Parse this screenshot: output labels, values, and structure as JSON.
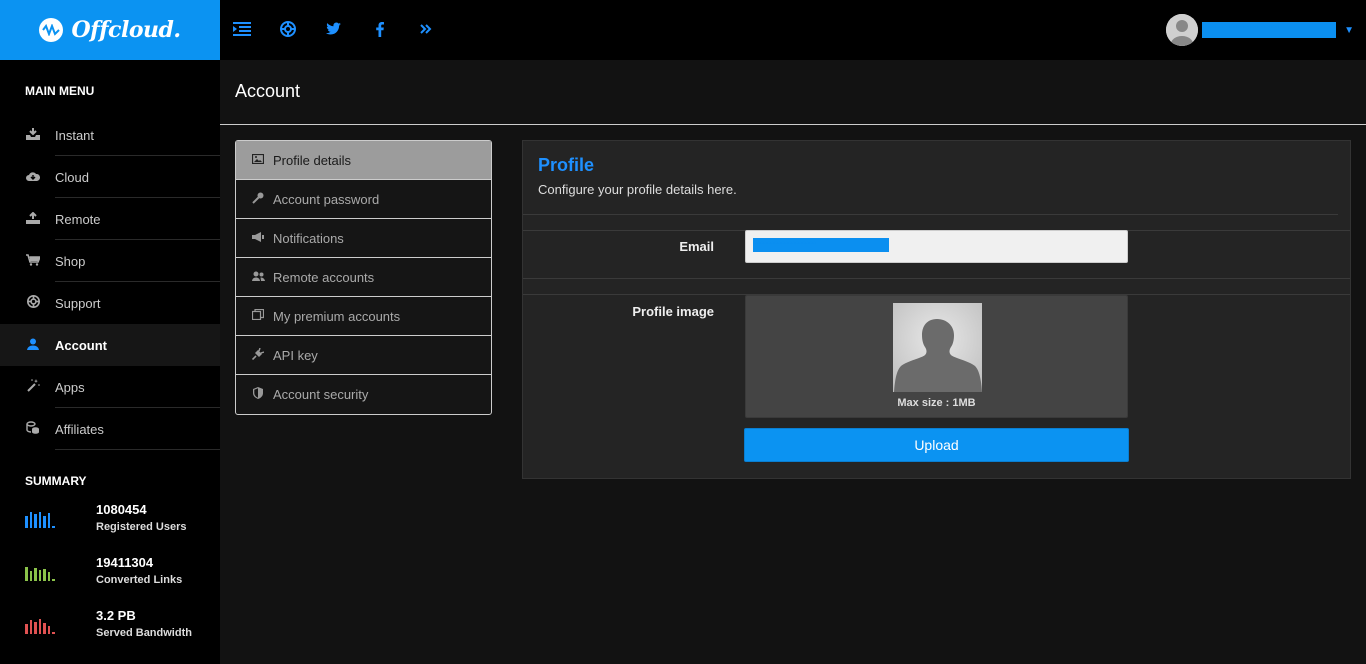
{
  "brand": {
    "name": "Offcloud."
  },
  "topbar": {
    "icons": [
      "menu-toggle-icon",
      "lifebuoy-icon",
      "twitter-icon",
      "facebook-icon",
      "chevron-double-right-icon"
    ]
  },
  "user": {
    "name": "••••••••••••••••••••••"
  },
  "sidebar": {
    "menu_heading": "MAIN MENU",
    "items": [
      {
        "label": "Instant",
        "icon": "download-tray-icon"
      },
      {
        "label": "Cloud",
        "icon": "cloud-download-icon"
      },
      {
        "label": "Remote",
        "icon": "upload-icon"
      },
      {
        "label": "Shop",
        "icon": "cart-icon"
      },
      {
        "label": "Support",
        "icon": "lifebuoy-icon"
      },
      {
        "label": "Account",
        "icon": "user-icon",
        "active": true
      },
      {
        "label": "Apps",
        "icon": "magic-wand-icon"
      },
      {
        "label": "Affiliates",
        "icon": "coins-icon"
      }
    ],
    "summary_heading": "SUMMARY",
    "stats": [
      {
        "value": "1080454",
        "label": "Registered Users",
        "color": "#1e90ff"
      },
      {
        "value": "19411304",
        "label": "Converted Links",
        "color": "#8bc34a"
      },
      {
        "value": "3.2 PB",
        "label": "Served Bandwidth",
        "color": "#e05252"
      }
    ]
  },
  "page": {
    "title": "Account"
  },
  "subnav": {
    "items": [
      {
        "label": "Profile details",
        "icon": "image-icon",
        "active": true
      },
      {
        "label": "Account password",
        "icon": "key-icon"
      },
      {
        "label": "Notifications",
        "icon": "megaphone-icon"
      },
      {
        "label": "Remote accounts",
        "icon": "users-icon"
      },
      {
        "label": "My premium accounts",
        "icon": "cards-icon"
      },
      {
        "label": "API key",
        "icon": "plug-icon"
      },
      {
        "label": "Account security",
        "icon": "shield-icon"
      }
    ]
  },
  "profile": {
    "title": "Profile",
    "subtitle": "Configure your profile details here.",
    "email_label": "Email",
    "email_value": "••••••••••••••••••",
    "image_label": "Profile image",
    "max_size": "Max size : 1MB",
    "upload_label": "Upload"
  },
  "colors": {
    "accent": "#0b93f2",
    "active_subnav": "#9c9c9c"
  }
}
